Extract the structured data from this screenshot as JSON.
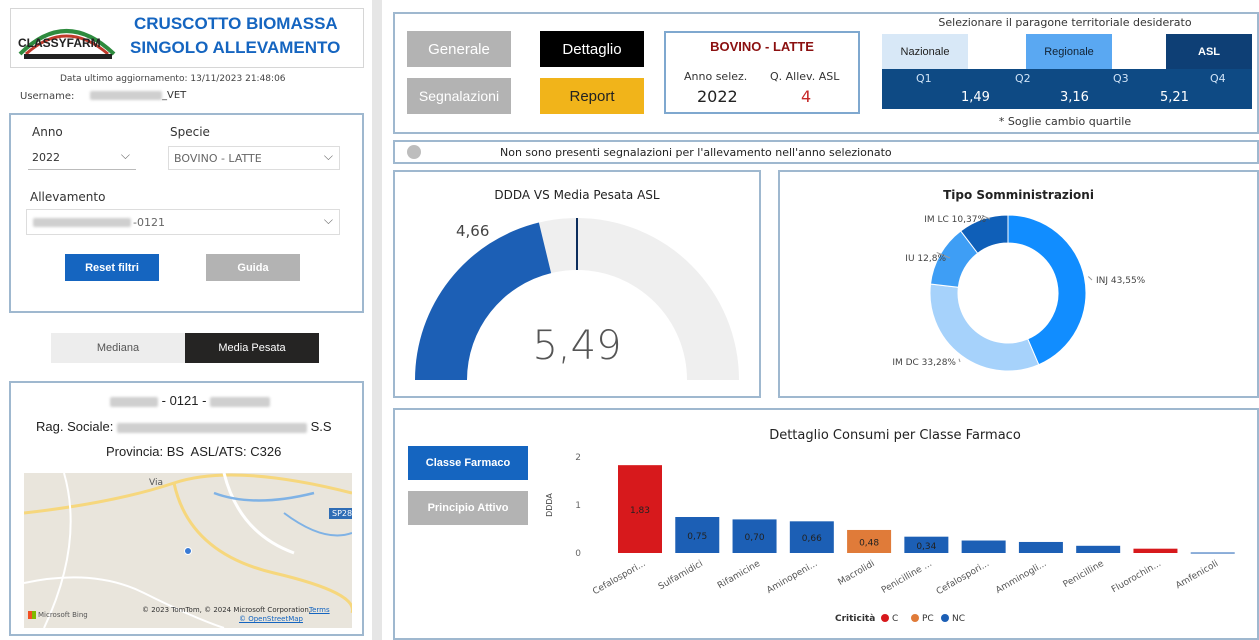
{
  "colors": {
    "dark_blue": "#0e4a84",
    "accent_blue": "#1e6cc0",
    "mid_blue": "#1c5fb5",
    "red": "#d7191c",
    "orange": "#e07b39",
    "grey_btn": "#b3b3b3",
    "yellow": "#f1b41a",
    "gauge_bg": "#efefef"
  },
  "header": {
    "logo_text": "CLASSYFARM",
    "title_line1": "CRUSCOTTO BIOMASSA",
    "title_line2": "SINGOLO ALLEVAMENTO",
    "last_update": "Data ultimo aggiornamento: 13/11/2023 21:48:06",
    "username_label": "Username:",
    "username_value": "_VET"
  },
  "filters": {
    "anno_label": "Anno",
    "anno_value": "2022",
    "specie_label": "Specie",
    "specie_value": "BOVINO - LATTE",
    "allevamento_label": "Allevamento",
    "allevamento_value": "-0121",
    "reset_label": "Reset filtri",
    "guida_label": "Guida"
  },
  "toggle": {
    "mediana": "Mediana",
    "media_pesata": "Media Pesata"
  },
  "farm_info": {
    "code_middle": "- 0121 -",
    "rag_sociale_label": "Rag. Sociale:",
    "rag_sociale_suffix": "S.S",
    "provincia": "Provincia: BS  ASL/ATS: C326"
  },
  "map": {
    "town_label": "Via",
    "road_label": "SP28",
    "bing": "Microsoft Bing",
    "copyright": "© 2023 TomTom, © 2024 Microsoft Corporation,",
    "terms": "Terms",
    "osm": "© OpenStreetMap"
  },
  "nav": {
    "generale": "Generale",
    "dettaglio": "Dettaglio",
    "segnalazioni": "Segnalazioni",
    "report": "Report"
  },
  "summary": {
    "species": "BOVINO - LATTE",
    "anno_label": "Anno selez.",
    "anno_value": "2022",
    "qallev_label": "Q. Allev. ASL",
    "qallev_value": "4"
  },
  "territorial": {
    "title": "Selezionare il paragone territoriale desiderato",
    "nazionale": "Nazionale",
    "regionale": "Regionale",
    "asl": "ASL",
    "q1": "Q1",
    "q2": "Q2",
    "q3": "Q3",
    "q4": "Q4",
    "t1": "1,49",
    "t2": "3,16",
    "t3": "5,21",
    "note": "* Soglie cambio quartile"
  },
  "alert": {
    "text": "Non sono presenti segnalazioni per l'allevamento nell'anno selezionato"
  },
  "gauge": {
    "title": "DDDA VS Media Pesata ASL",
    "value_label": "4,66",
    "center_label": "5,49",
    "value": 4.66,
    "target": 5.49,
    "max": 10.98
  },
  "donut": {
    "title": "Tipo Somministrazioni",
    "slices": [
      {
        "label": "INJ 43,55%",
        "value": 43.55,
        "color": "#118dff"
      },
      {
        "label": "IM DC 33,28%",
        "value": 33.28,
        "color": "#a6d2fb"
      },
      {
        "label": "IU 12,8%",
        "value": 12.8,
        "color": "#3e9ef5"
      },
      {
        "label": "IM LC 10,37%",
        "value": 10.37,
        "color": "#0f5fb8"
      }
    ]
  },
  "bars_panel": {
    "classe_farmaco": "Classe Farmaco",
    "principio_attivo": "Principio Attivo"
  },
  "chart_data": {
    "type": "bar",
    "title": "Dettaglio Consumi per Classe Farmaco",
    "ylabel": "DDDA",
    "xlabel": "",
    "ylim": [
      0,
      2
    ],
    "yticks": [
      "0",
      "1",
      "2"
    ],
    "categories": [
      "Cefalospori...",
      "Sulfamidici",
      "Rifamicine",
      "Aminopeni...",
      "Macrolidi",
      "Penicilline ...",
      "Cefalospori...",
      "Amminogli...",
      "Penicilline",
      "Fluorochin...",
      "Amfenicoli"
    ],
    "values": [
      1.83,
      0.75,
      0.7,
      0.66,
      0.48,
      0.34,
      0.26,
      0.23,
      0.15,
      0.09,
      0.01
    ],
    "value_labels": [
      "1,83",
      "0,75",
      "0,70",
      "0,66",
      "0,48",
      "0,34",
      "",
      "",
      "",
      "",
      ""
    ],
    "criticita": [
      "C",
      "NC",
      "NC",
      "NC",
      "PC",
      "NC",
      "NC",
      "NC",
      "NC",
      "C",
      "NC"
    ],
    "legend_title": "Criticità",
    "legend": [
      {
        "label": "C",
        "color": "#d7191c"
      },
      {
        "label": "PC",
        "color": "#e07b39"
      },
      {
        "label": "NC",
        "color": "#1c5fb5"
      }
    ]
  }
}
